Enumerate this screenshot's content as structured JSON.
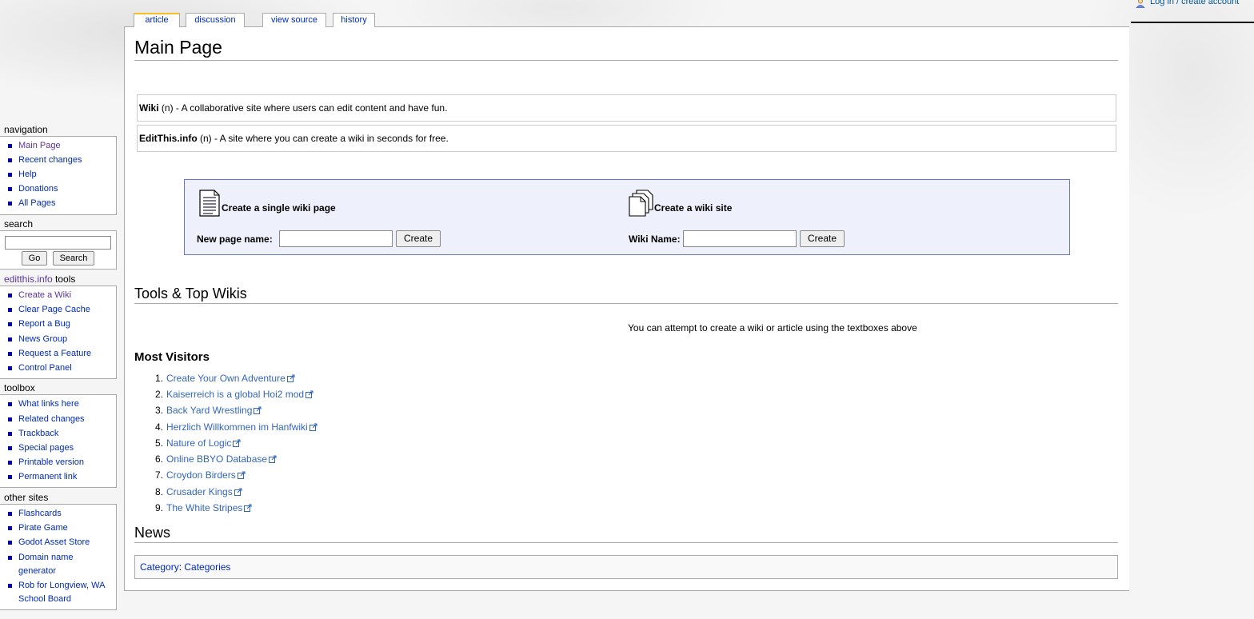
{
  "personal": {
    "login": "Log in / create account"
  },
  "tabs": [
    {
      "label": "article",
      "selected": true
    },
    {
      "label": "discussion"
    },
    {
      "label": "view source"
    },
    {
      "label": "history"
    }
  ],
  "content": {
    "title": "Main Page",
    "defs": [
      {
        "term": "Wiki",
        "rest": " (n) - A collaborative site where users can edit content and have fun."
      },
      {
        "term": "EditThis.info",
        "rest": " (n) - A site where you can create a wiki in seconds for free."
      }
    ],
    "create_page": {
      "title": "Create a single wiki page",
      "label": "New page name:",
      "button": "Create"
    },
    "create_site": {
      "title": "Create a wiki site",
      "label": "Wiki Name:",
      "button": "Create"
    },
    "tools_heading": "Tools & Top Wikis",
    "note": "You can attempt to create a wiki or article using the textboxes above",
    "most_visitors_heading": "Most Visitors",
    "most_visitors": [
      "Create Your Own Adventure",
      "Kaiserreich is a global Hoi2 mod",
      "Back Yard Wrestling",
      "Herzlich Willkommen im Hanfwiki",
      "Nature of Logic",
      "Online BBYO Database",
      "Croydon Birders",
      "Crusader Kings",
      "The White Stripes"
    ],
    "news_heading": "News",
    "category_label": "Category",
    "category_value": "Categories"
  },
  "sidebar": {
    "navigation": {
      "heading": "navigation",
      "items": [
        "Main Page",
        "Recent changes",
        "Help",
        "Donations",
        "All Pages"
      ]
    },
    "search": {
      "heading": "search",
      "go": "Go",
      "search": "Search"
    },
    "tools": {
      "heading_link": "editthis.info",
      "heading_rest": " tools",
      "items": [
        "Create a Wiki",
        "Clear Page Cache",
        "Report a Bug",
        "News Group",
        "Request a Feature",
        "Control Panel"
      ]
    },
    "toolbox": {
      "heading": "toolbox",
      "items": [
        "What links here",
        "Related changes",
        "Trackback",
        "Special pages",
        "Printable version",
        "Permanent link"
      ]
    },
    "other": {
      "heading": "other sites",
      "items": [
        "Flashcards",
        "Pirate Game",
        "Godot Asset Store",
        "Domain name generator",
        "Rob for Longview, WA School Board"
      ]
    }
  }
}
